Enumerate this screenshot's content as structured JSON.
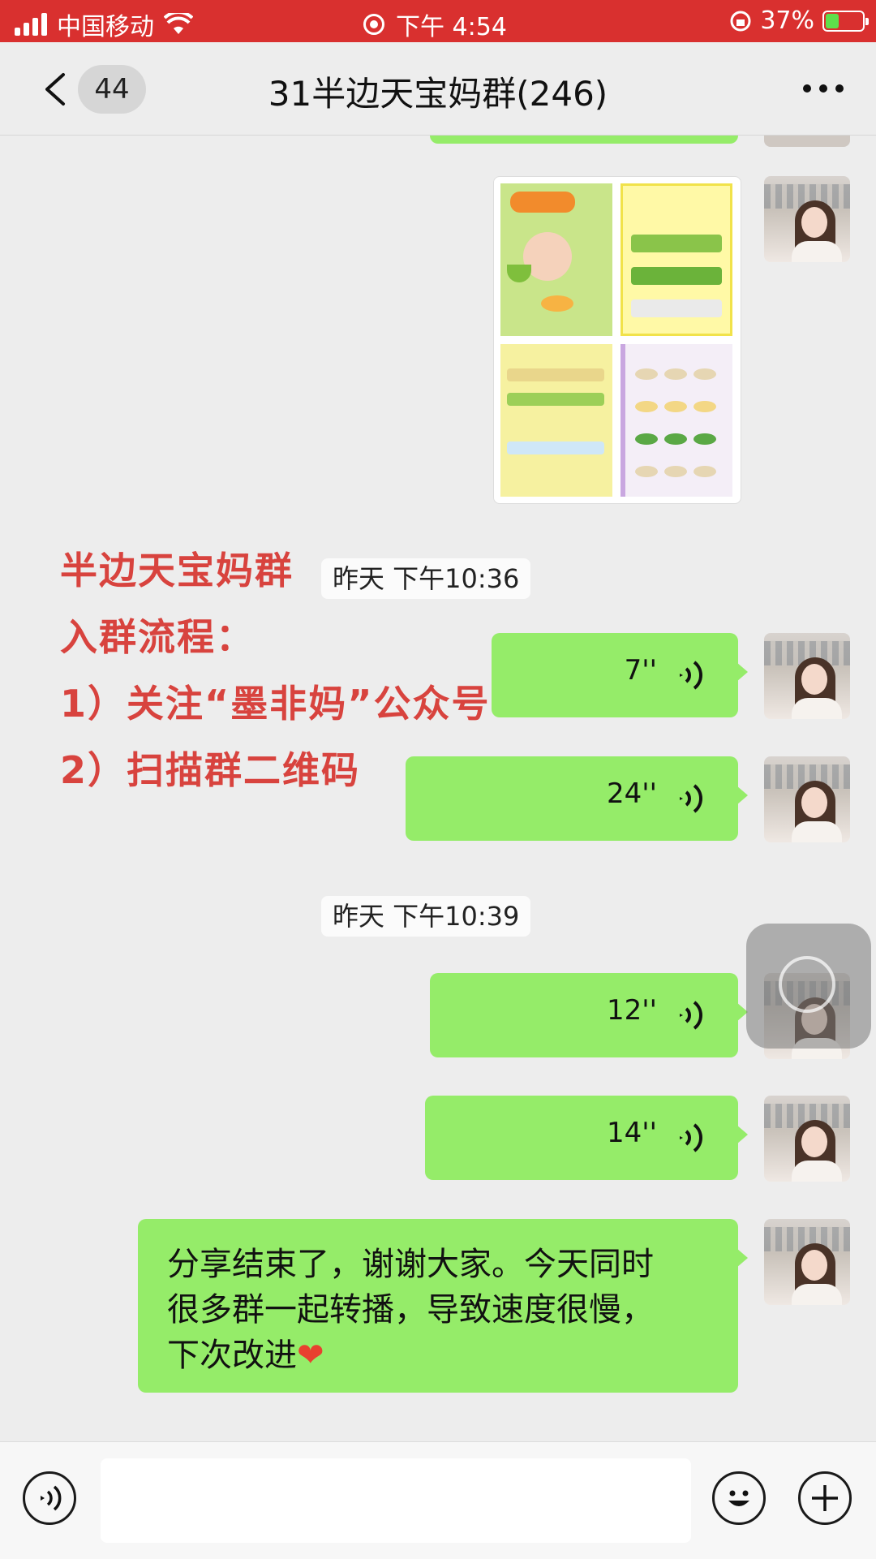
{
  "status_bar": {
    "carrier": "中国移动",
    "time": "下午 4:54",
    "battery_percent": "37%",
    "battery_level": 0.37
  },
  "header": {
    "back_count": "44",
    "title": "31半边天宝妈群(246)"
  },
  "messages": {
    "timestamp_1": "昨天 下午10:36",
    "timestamp_2": "昨天 下午10:39",
    "voice_1": "7''",
    "voice_2": "24''",
    "voice_3": "12''",
    "voice_4": "14''",
    "text_final_1": "分享结束了，谢谢大家。今天同时",
    "text_final_2": "很多群一起转播，导致速度很慢，",
    "text_final_3": "下次改进",
    "heart": "❤"
  },
  "overlay_text": {
    "line_1": "半边天宝妈群",
    "line_2": "入群流程：",
    "line_3": "1）关注“墨非妈”公众号",
    "line_4": "2）扫描群二维码"
  },
  "input_bar": {
    "placeholder": ""
  },
  "colors": {
    "status_bar_bg": "#d9302f",
    "bubble_green": "#95ec69",
    "chat_bg": "#ededed"
  }
}
